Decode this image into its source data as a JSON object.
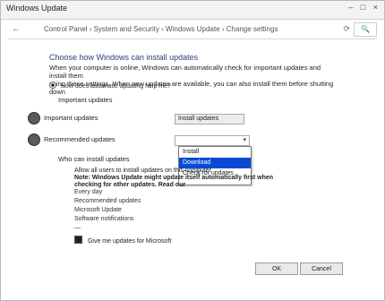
{
  "window": {
    "title": "Windows Update",
    "controls": "– □ ×"
  },
  "header": {
    "back": "←",
    "breadcrumb": "Control Panel  ›  System and Security  ›  Windows Update  ›  Change settings",
    "refresh": "⟳",
    "search_placeholder": "🔍"
  },
  "main": {
    "heading": "Choose how Windows can install updates",
    "description_line1": "When your computer is online, Windows can automatically check for important updates and install them",
    "description_line2": "using these settings. When new updates are available, you can also install them before shutting down",
    "radio_text": "How does automatic updating help me?",
    "important_updates_title": "Important updates",
    "important_updates_combo": "Install updates",
    "recommended_label": "Recommended updates",
    "recommended_combo": "",
    "dropdown_options": [
      "Install",
      "Download",
      "Check for updates"
    ],
    "selected_option_index": 1,
    "who_can_install_title": "Who can install updates",
    "note_line1": "Allow all users to install updates on this computer",
    "note_line2": "Note: Windows Update might update itself automatically first when checking for other updates. Read our",
    "items": [
      "Every day",
      "Recommended updates",
      "Microsoft Update",
      "Software notifications",
      "—"
    ],
    "checkbox_label": "Give me updates for Microsoft",
    "ok_label": "OK",
    "cancel_label": "Cancel"
  }
}
